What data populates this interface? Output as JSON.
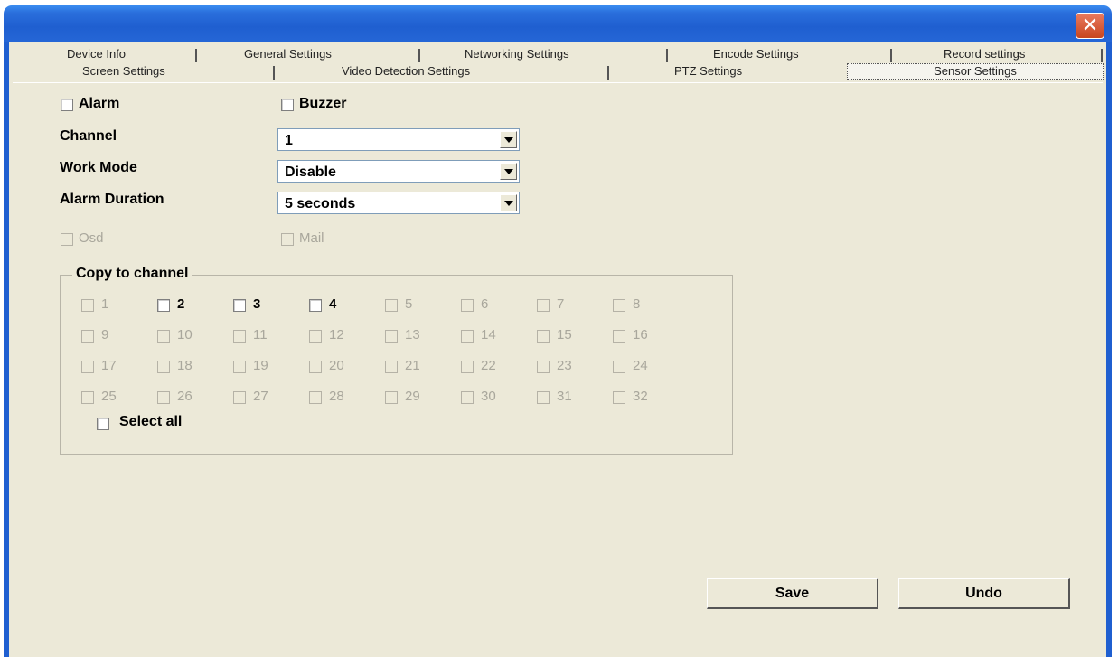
{
  "window": {
    "close_label": "✕"
  },
  "tabs": {
    "row1": [
      "Device Info",
      "General Settings",
      "Networking Settings",
      "Encode Settings",
      "Record settings"
    ],
    "row2": [
      "Screen Settings",
      "Video Detection Settings",
      "PTZ Settings",
      "Sensor Settings"
    ],
    "active": "Sensor Settings"
  },
  "options": {
    "alarm": "Alarm",
    "buzzer": "Buzzer",
    "osd": "Osd",
    "mail": "Mail"
  },
  "fields": {
    "channel": {
      "label": "Channel",
      "value": "1"
    },
    "work_mode": {
      "label": "Work Mode",
      "value": "Disable"
    },
    "alarm_duration": {
      "label": "Alarm Duration",
      "value": "5 seconds"
    }
  },
  "copy": {
    "title": "Copy to channel",
    "channels": [
      "1",
      "2",
      "3",
      "4",
      "5",
      "6",
      "7",
      "8",
      "9",
      "10",
      "11",
      "12",
      "13",
      "14",
      "15",
      "16",
      "17",
      "18",
      "19",
      "20",
      "21",
      "22",
      "23",
      "24",
      "25",
      "26",
      "27",
      "28",
      "29",
      "30",
      "31",
      "32"
    ],
    "enabled": [
      "2",
      "3",
      "4"
    ],
    "select_all": "Select all"
  },
  "buttons": {
    "save": "Save",
    "undo": "Undo"
  }
}
